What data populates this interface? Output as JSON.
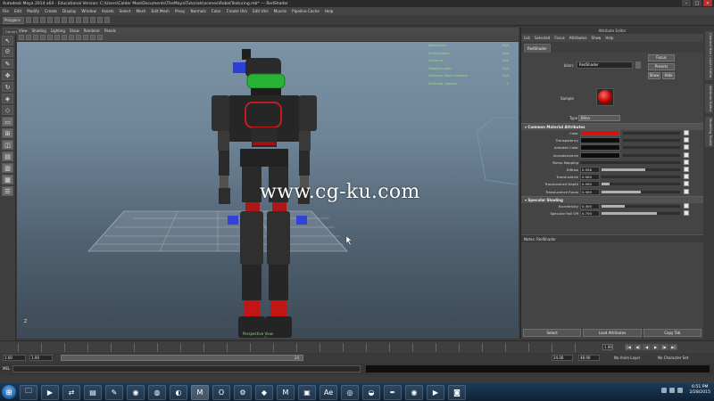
{
  "window": {
    "title": "Autodesk Maya 2014 x64 - Educational Version: C:\\Users\\Calder Moe\\Documents\\TheMaya\\Tutorials\\scenes\\RobotTexturing.mb* --- RedShader"
  },
  "menubar": [
    "File",
    "Edit",
    "Modify",
    "Create",
    "Display",
    "Window",
    "Assets",
    "Select",
    "Mesh",
    "Edit Mesh",
    "Proxy",
    "Normals",
    "Color",
    "Create UVs",
    "Edit UVs",
    "Muscle",
    "Pipeline Cache",
    "Help"
  ],
  "statusline": {
    "mode": "Polygons"
  },
  "shelf_tabs": [
    "General",
    "Curves",
    "Surfaces",
    "Polygons",
    "Subdivs",
    "Deformation",
    "Animation",
    "Dynamics",
    "Rendering",
    "PaintEffects",
    "Toon",
    "Muscle",
    "Fluids",
    "Fur",
    "nHair",
    "nCloth",
    "Custom"
  ],
  "viewport": {
    "menu": [
      "View",
      "Shading",
      "Lighting",
      "Show",
      "Renderer",
      "Panels"
    ],
    "hud": [
      {
        "label": "Backfaces:",
        "value": "N/A"
      },
      {
        "label": "Smoothness:",
        "value": "N/A"
      },
      {
        "label": "Instance:",
        "value": "N/A"
      },
      {
        "label": "Display Layer:",
        "value": "N/A"
      },
      {
        "label": "Distance From Camera:",
        "value": "N/A"
      },
      {
        "label": "Selected Objects:",
        "value": "1"
      }
    ],
    "watermark": "www.cg-ku.com",
    "camera_label": "Perspective View",
    "axis": "Z"
  },
  "attribute_editor": {
    "title": "Attribute Editor",
    "menu": [
      "List",
      "Selected",
      "Focus",
      "Attributes",
      "Show",
      "Help"
    ],
    "tab": "RedShader",
    "blinn_label": "blinn:",
    "blinn_value": "RedShader",
    "focus_button": "Focus",
    "presets_button": "Presets",
    "show_button": "Show",
    "hide_button": "Hide",
    "sample_label": "Sample",
    "type_label": "Type",
    "type_value": "Blinn",
    "section_common": "Common Material Attributes",
    "common_attrs": [
      {
        "label": "Color",
        "kind": "color",
        "color": "#d81010"
      },
      {
        "label": "Transparency",
        "kind": "color",
        "color": "#0d0d0d"
      },
      {
        "label": "Ambient Color",
        "kind": "color",
        "color": "#0d0d0d"
      },
      {
        "label": "Incandescence",
        "kind": "color",
        "color": "#0d0d0d"
      },
      {
        "label": "Bump Mapping",
        "kind": "blank"
      },
      {
        "label": "Diffuse",
        "kind": "value",
        "value": "0.558",
        "fill": 0.558
      },
      {
        "label": "Translucence",
        "kind": "value",
        "value": "0.000",
        "fill": 0.0
      },
      {
        "label": "Translucence Depth",
        "kind": "value",
        "value": "0.500",
        "fill": 0.1
      },
      {
        "label": "Translucence Focus",
        "kind": "value",
        "value": "0.500",
        "fill": 0.5
      }
    ],
    "section_specular": "Specular Shading",
    "specular_attrs": [
      {
        "label": "Eccentricity",
        "kind": "value",
        "value": "0.300",
        "fill": 0.3
      },
      {
        "label": "Specular Roll Off",
        "kind": "value",
        "value": "0.700",
        "fill": 0.7
      }
    ],
    "notes_label": "Notes: RedShader",
    "bottom_buttons": [
      "Select",
      "Load Attributes",
      "Copy Tab"
    ]
  },
  "side_tabs": [
    "Channel Box / Layer Editor",
    "Attribute Editor",
    "Modeling Toolkit"
  ],
  "time": {
    "current_frame": "1.00",
    "range_start": "1.00",
    "anim_start": "1.00",
    "range_field_end": "24.00",
    "anim_end": "48.00",
    "range_bar_label": "24",
    "no_anim_layer": "No Anim Layer",
    "no_char_set": "No Character Set"
  },
  "cmdline": {
    "label": "MEL"
  },
  "taskbar": {
    "clock_time": "6:51 PM",
    "clock_date": "2/28/2015"
  }
}
